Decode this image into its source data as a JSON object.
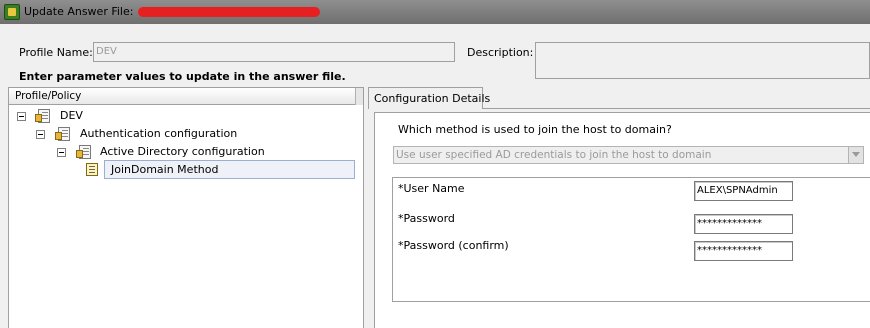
{
  "window": {
    "title": "Update Answer File:"
  },
  "profile": {
    "name_label": "Profile Name:",
    "name_value": "DEV",
    "description_label": "Description:",
    "description_value": ""
  },
  "instructions": "Enter parameter values to update in the answer file.",
  "tree": {
    "header": "Profile/Policy",
    "nodes": [
      {
        "label": "DEV"
      },
      {
        "label": "Authentication configuration"
      },
      {
        "label": "Active Directory configuration"
      },
      {
        "label": "JoinDomain Method",
        "selected": true
      }
    ]
  },
  "config": {
    "tab_label": "Configuration Details",
    "question": "Which method is used to join the host to domain?",
    "method_value": "Use user specified AD credentials to join the host to domain",
    "fields": [
      {
        "label": "*User Name",
        "value": "ALEX\\SPNAdmin"
      },
      {
        "label": "*Password",
        "value": "*************"
      },
      {
        "label": "*Password (confirm)",
        "value": "*************"
      }
    ]
  },
  "colors": {
    "titlebar": "#7f7f7f",
    "redaction": "#e62020",
    "selection": "#eef2f8"
  }
}
